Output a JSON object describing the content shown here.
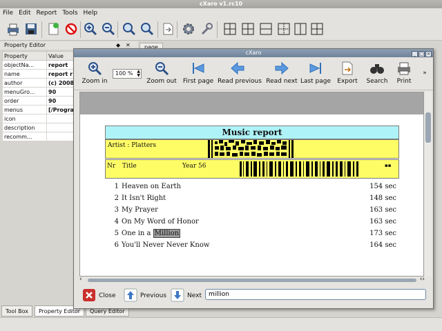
{
  "app": {
    "title": "cXaro v1.rc10"
  },
  "menubar": {
    "items": [
      "File",
      "Edit",
      "Report",
      "Tools",
      "Help"
    ]
  },
  "property_editor": {
    "title": "Property Editor",
    "controls": [
      "◆",
      "✕"
    ],
    "tab": "page",
    "columns": [
      "Property",
      "Value"
    ],
    "rows": [
      {
        "prop": "objectNa...",
        "value": "report"
      },
      {
        "prop": "name",
        "value": "report r"
      },
      {
        "prop": "author",
        "value": "(c) 2008"
      },
      {
        "prop": "menuGro...",
        "value": "90"
      },
      {
        "prop": "order",
        "value": "90"
      },
      {
        "prop": "menus",
        "value": "[/Progra"
      },
      {
        "prop": "icon",
        "value": ""
      },
      {
        "prop": "description",
        "value": ""
      },
      {
        "prop": "recomm...",
        "value": ""
      }
    ]
  },
  "bottom_tabs": [
    "Tool Box",
    "Property Editor",
    "Query Editor"
  ],
  "dialog": {
    "title": "cXaro",
    "toolbar": {
      "zoom_in": "Zoom in",
      "zoom_value": "100 %",
      "zoom_out": "Zoom out",
      "first_page": "First page",
      "read_previous": "Read previous",
      "read_next": "Read next",
      "last_page": "Last page",
      "export": "Export",
      "search": "Search",
      "print": "Print",
      "more": "»"
    },
    "report": {
      "title": "Music report",
      "artist": "Artist : Platters",
      "header": {
        "nr": "Nr",
        "title": "Title",
        "year": "Year 56",
        "mark": "▪▪"
      },
      "rows": [
        {
          "nr": "1",
          "title": "Heaven on Earth",
          "duration": "154 sec"
        },
        {
          "nr": "2",
          "title": "It Isn't Right",
          "duration": "148 sec"
        },
        {
          "nr": "3",
          "title": "My Prayer",
          "duration": "163 sec"
        },
        {
          "nr": "4",
          "title": "On My Word of Honor",
          "duration": "163 sec"
        },
        {
          "nr": "5",
          "title_before": "One in a",
          "title_highlight": "Million",
          "duration": "173 sec"
        },
        {
          "nr": "6",
          "title": "You'll Never Never Know",
          "duration": "164 sec"
        }
      ]
    },
    "findbar": {
      "close": "Close",
      "previous": "Previous",
      "next": "Next",
      "query": "million"
    },
    "colors": {
      "title_band": "#aef3f7",
      "yellow_band": "#fffd66",
      "highlight": "#9e9e9e"
    }
  }
}
